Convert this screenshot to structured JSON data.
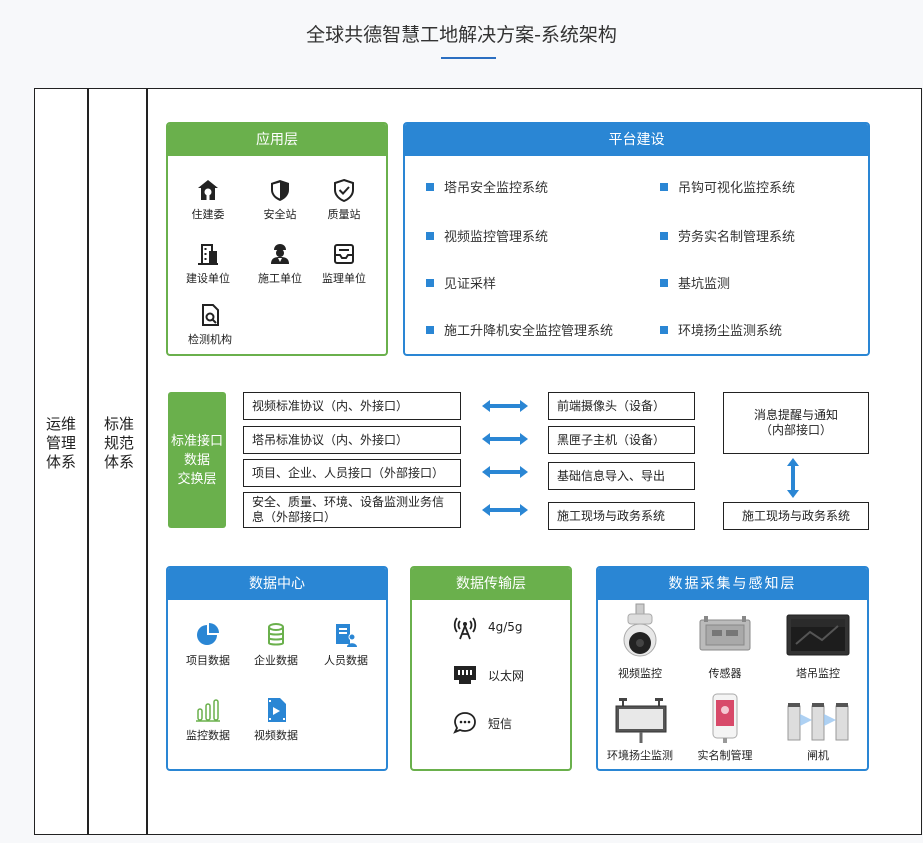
{
  "page": {
    "title": "全球共德智慧工地解决方案-系统架构"
  },
  "side": {
    "ops": "运维管理体系",
    "std": "标准规范体系"
  },
  "app_layer": {
    "title": "应用层",
    "items": [
      {
        "label": "住建委",
        "icon": "house-shield-icon"
      },
      {
        "label": "安全站",
        "icon": "shield-icon"
      },
      {
        "label": "质量站",
        "icon": "check-shield-icon"
      },
      {
        "label": "建设单位",
        "icon": "building-icon"
      },
      {
        "label": "施工单位",
        "icon": "worker-icon"
      },
      {
        "label": "监理单位",
        "icon": "inbox-icon"
      },
      {
        "label": "检测机构",
        "icon": "inspect-doc-icon"
      }
    ]
  },
  "platform": {
    "title": "平台建设",
    "items": [
      "塔吊安全监控系统",
      "吊钩可视化监控系统",
      "视频监控管理系统",
      "劳务实名制管理系统",
      "见证采样",
      "基坑监测",
      "施工升降机安全监控管理系统",
      "环境扬尘监测系统"
    ]
  },
  "exchange": {
    "title": "标准接口\n数据\n交换层",
    "protocols": [
      "视频标准协议（内、外接口）",
      "塔吊标准协议（内、外接口）",
      "项目、企业、人员接口（外部接口）",
      "安全、质量、环境、设备监测业务信息（外部接口）"
    ],
    "targets": [
      "前端摄像头（设备）",
      "黑匣子主机（设备）",
      "基础信息导入、导出",
      "施工现场与政务系统"
    ],
    "notify": "消息提醒与通知\n（内部接口）",
    "gov": "施工现场与政务系统"
  },
  "data_center": {
    "title": "数据中心",
    "items": [
      {
        "label": "项目数据",
        "icon": "pie-icon"
      },
      {
        "label": "企业数据",
        "icon": "database-icon"
      },
      {
        "label": "人员数据",
        "icon": "person-card-icon"
      },
      {
        "label": "监控数据",
        "icon": "bars-icon"
      },
      {
        "label": "视频数据",
        "icon": "video-file-icon"
      }
    ]
  },
  "transport": {
    "title": "数据传输层",
    "items": [
      {
        "label": "4g/5g",
        "icon": "antenna-icon"
      },
      {
        "label": "以太网",
        "icon": "ethernet-icon"
      },
      {
        "label": "短信",
        "icon": "chat-icon"
      }
    ]
  },
  "sensing": {
    "title": "数据采集与感知层",
    "items": [
      {
        "label": "视频监控",
        "icon": "dome-camera-icon"
      },
      {
        "label": "传感器",
        "icon": "sensor-box-icon"
      },
      {
        "label": "塔吊监控",
        "icon": "monitor-screen-icon"
      },
      {
        "label": "环境扬尘监测",
        "icon": "dust-station-icon"
      },
      {
        "label": "实名制管理",
        "icon": "face-terminal-icon"
      },
      {
        "label": "闸机",
        "icon": "turnstile-icon"
      }
    ]
  },
  "colors": {
    "green": "#6ab04c",
    "blue": "#2a86d4"
  }
}
